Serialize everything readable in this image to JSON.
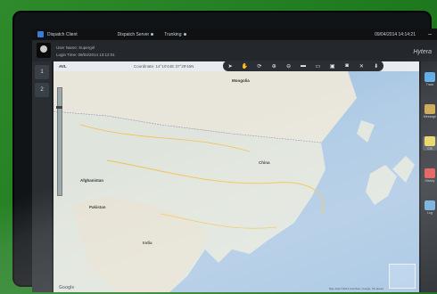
{
  "window": {
    "title": "Dispatch Client",
    "clock": "09/04/2014 14:14:21",
    "minimize": "–"
  },
  "status": [
    {
      "label": "Dispatch Server"
    },
    {
      "label": "Trunking"
    }
  ],
  "user": {
    "name_line": "User Name: Supergirl",
    "login_line": "Login Time: 09/04/2014 13:12:01"
  },
  "brand": {
    "name": "Hytera"
  },
  "left_tools": [
    "1",
    "2"
  ],
  "map": {
    "tab": "AVL",
    "coords": "Coordinate: 14°10'44E 37°29'46N",
    "tools": [
      "cursor",
      "hand",
      "rotate",
      "zoom-in",
      "zoom-out",
      "measure",
      "rect",
      "layer",
      "camera",
      "close",
      "pin"
    ],
    "labels": {
      "mongolia": "Mongolia",
      "china": "China",
      "pakistan": "Pakistan",
      "india": "India",
      "afghanistan": "Afghanistan"
    },
    "copyright": "Map data ©2014 AutoNavi, Google, SK planet",
    "google": "Google"
  },
  "right_panel": [
    {
      "label": "Track",
      "color": "#5aa9e6"
    },
    {
      "label": "Message",
      "color": "#c8a24a"
    },
    {
      "label": "GIS",
      "color": "#e6d25a"
    },
    {
      "label": "History",
      "color": "#e04a4a"
    },
    {
      "label": "Log",
      "color": "#6aa8d8"
    }
  ]
}
